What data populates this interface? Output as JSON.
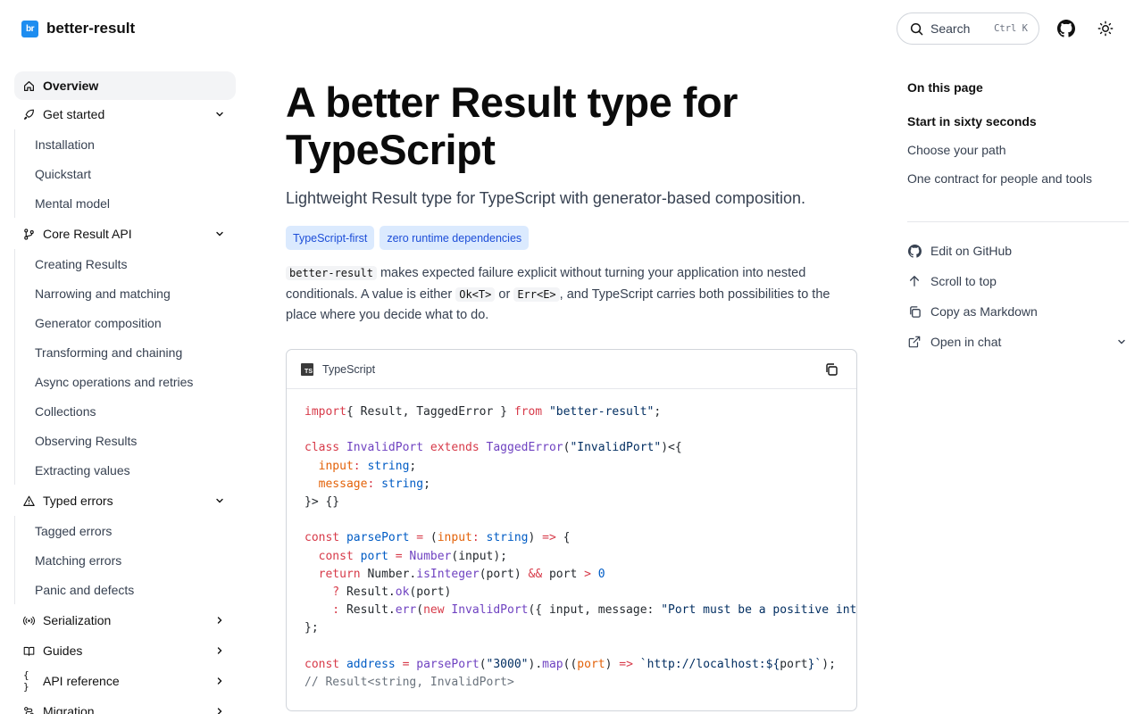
{
  "header": {
    "logo_mark": "br",
    "site_name": "better-result",
    "search_label": "Search",
    "search_shortcut": "Ctrl K",
    "icons": [
      "search-icon",
      "github-icon",
      "sun-icon"
    ]
  },
  "sidebar": {
    "items": [
      {
        "label": "Overview",
        "icon": "home-icon",
        "active": true
      },
      {
        "label": "Get started",
        "icon": "rocket-icon",
        "expanded": true,
        "children": [
          "Installation",
          "Quickstart",
          "Mental model"
        ]
      },
      {
        "label": "Core Result API",
        "icon": "branch-icon",
        "expanded": true,
        "children": [
          "Creating Results",
          "Narrowing and matching",
          "Generator composition",
          "Transforming and chaining",
          "Async operations and retries",
          "Collections",
          "Observing Results",
          "Extracting values"
        ]
      },
      {
        "label": "Typed errors",
        "icon": "warning-icon",
        "expanded": true,
        "children": [
          "Tagged errors",
          "Matching errors",
          "Panic and defects"
        ]
      },
      {
        "label": "Serialization",
        "icon": "broadcast-icon",
        "expanded": false
      },
      {
        "label": "Guides",
        "icon": "book-icon",
        "expanded": false
      },
      {
        "label": "API reference",
        "icon": "braces-icon",
        "expanded": false
      },
      {
        "label": "Migration",
        "icon": "migration-icon",
        "expanded": false
      }
    ]
  },
  "main": {
    "title": "A better Result type for TypeScript",
    "subtitle": "Lightweight Result type for TypeScript with generator-based composition.",
    "badges": [
      "TypeScript-first",
      "zero runtime dependencies"
    ],
    "intro": {
      "code1": "better-result",
      "text1": " makes expected failure explicit without turning your application into nested conditionals. A value is either ",
      "code2": "Ok<T>",
      "text2": " or ",
      "code3": "Err<E>",
      "text3": ", and TypeScript carries both possibilities to the place where you decide what to do."
    },
    "code_block": {
      "language": "TypeScript",
      "lang_icon": "TS",
      "lines": [
        [
          [
            "k",
            "import"
          ],
          [
            "",
            "{ Result, TaggedError } "
          ],
          [
            "k",
            "from"
          ],
          [
            "s",
            " \"better-result\""
          ],
          [
            "",
            ";"
          ]
        ],
        [],
        [
          [
            "k",
            "class"
          ],
          [
            "f",
            " InvalidPort"
          ],
          [
            "k",
            " extends"
          ],
          [
            "f",
            " TaggedError"
          ],
          [
            "",
            "("
          ],
          [
            "s",
            "\"InvalidPort\""
          ],
          [
            "",
            ")<{"
          ]
        ],
        [
          [
            "p",
            "  input"
          ],
          [
            "k",
            ":"
          ],
          [
            "v",
            " string"
          ],
          [
            "",
            ";"
          ]
        ],
        [
          [
            "p",
            "  message"
          ],
          [
            "k",
            ":"
          ],
          [
            "v",
            " string"
          ],
          [
            "",
            ";"
          ]
        ],
        [
          [
            "",
            "}> {}"
          ]
        ],
        [],
        [
          [
            "k",
            "const"
          ],
          [
            "v",
            " parsePort"
          ],
          [
            "k",
            " ="
          ],
          [
            "",
            " ("
          ],
          [
            "p",
            "input"
          ],
          [
            "k",
            ":"
          ],
          [
            "v",
            " string"
          ],
          [
            "",
            ") "
          ],
          [
            "k",
            "=>"
          ],
          [
            "",
            " {"
          ]
        ],
        [
          [
            "k",
            "  const"
          ],
          [
            "v",
            " port"
          ],
          [
            "k",
            " ="
          ],
          [
            "f",
            " Number"
          ],
          [
            "",
            "(input);"
          ]
        ],
        [
          [
            "k",
            "  return"
          ],
          [
            "",
            " Number."
          ],
          [
            "f",
            "isInteger"
          ],
          [
            "",
            "(port) "
          ],
          [
            "k",
            "&&"
          ],
          [
            "",
            " port "
          ],
          [
            "k",
            ">"
          ],
          [
            "v",
            " 0"
          ]
        ],
        [
          [
            "k",
            "    ?"
          ],
          [
            "",
            " Result."
          ],
          [
            "f",
            "ok"
          ],
          [
            "",
            "(port)"
          ]
        ],
        [
          [
            "k",
            "    :"
          ],
          [
            "",
            " Result."
          ],
          [
            "f",
            "err"
          ],
          [
            "",
            "("
          ],
          [
            "k",
            "new"
          ],
          [
            "f",
            " InvalidPort"
          ],
          [
            "",
            "({ input, message: "
          ],
          [
            "s",
            "\"Port must be a positive integer\""
          ],
          [
            "",
            "}));"
          ]
        ],
        [
          [
            "",
            "};"
          ]
        ],
        [],
        [
          [
            "k",
            "const"
          ],
          [
            "v",
            " address"
          ],
          [
            "k",
            " ="
          ],
          [
            "f",
            " parsePort"
          ],
          [
            "",
            "("
          ],
          [
            "s",
            "\"3000\""
          ],
          [
            "",
            ")."
          ],
          [
            "f",
            "map"
          ],
          [
            "",
            "(("
          ],
          [
            "p",
            "port"
          ],
          [
            "",
            ") "
          ],
          [
            "k",
            "=>"
          ],
          [
            "s",
            " `http://localhost:${"
          ],
          [
            "",
            "port"
          ],
          [
            "s",
            "}`"
          ],
          [
            "",
            ");"
          ]
        ],
        [
          [
            "c",
            "// Result<string, InvalidPort>"
          ]
        ]
      ]
    }
  },
  "toc": {
    "title": "On this page",
    "items": [
      {
        "label": "Start in sixty seconds",
        "active": true
      },
      {
        "label": "Choose your path",
        "active": false
      },
      {
        "label": "One contract for people and tools",
        "active": false
      }
    ],
    "actions": [
      {
        "label": "Edit on GitHub",
        "icon": "github-icon"
      },
      {
        "label": "Scroll to top",
        "icon": "arrow-up-icon"
      },
      {
        "label": "Copy as Markdown",
        "icon": "copy-icon"
      },
      {
        "label": "Open in chat",
        "icon": "external-link-icon",
        "chevron": true
      }
    ]
  },
  "colors": {
    "accent": "#1d8df0",
    "badge_bg": "#dbeafe",
    "badge_text": "#1d4ed8",
    "keyword": "#d73a49",
    "string": "#032f62",
    "function": "#6f42c1",
    "variable": "#005cc5",
    "param": "#e36209",
    "comment": "#6a737d"
  }
}
